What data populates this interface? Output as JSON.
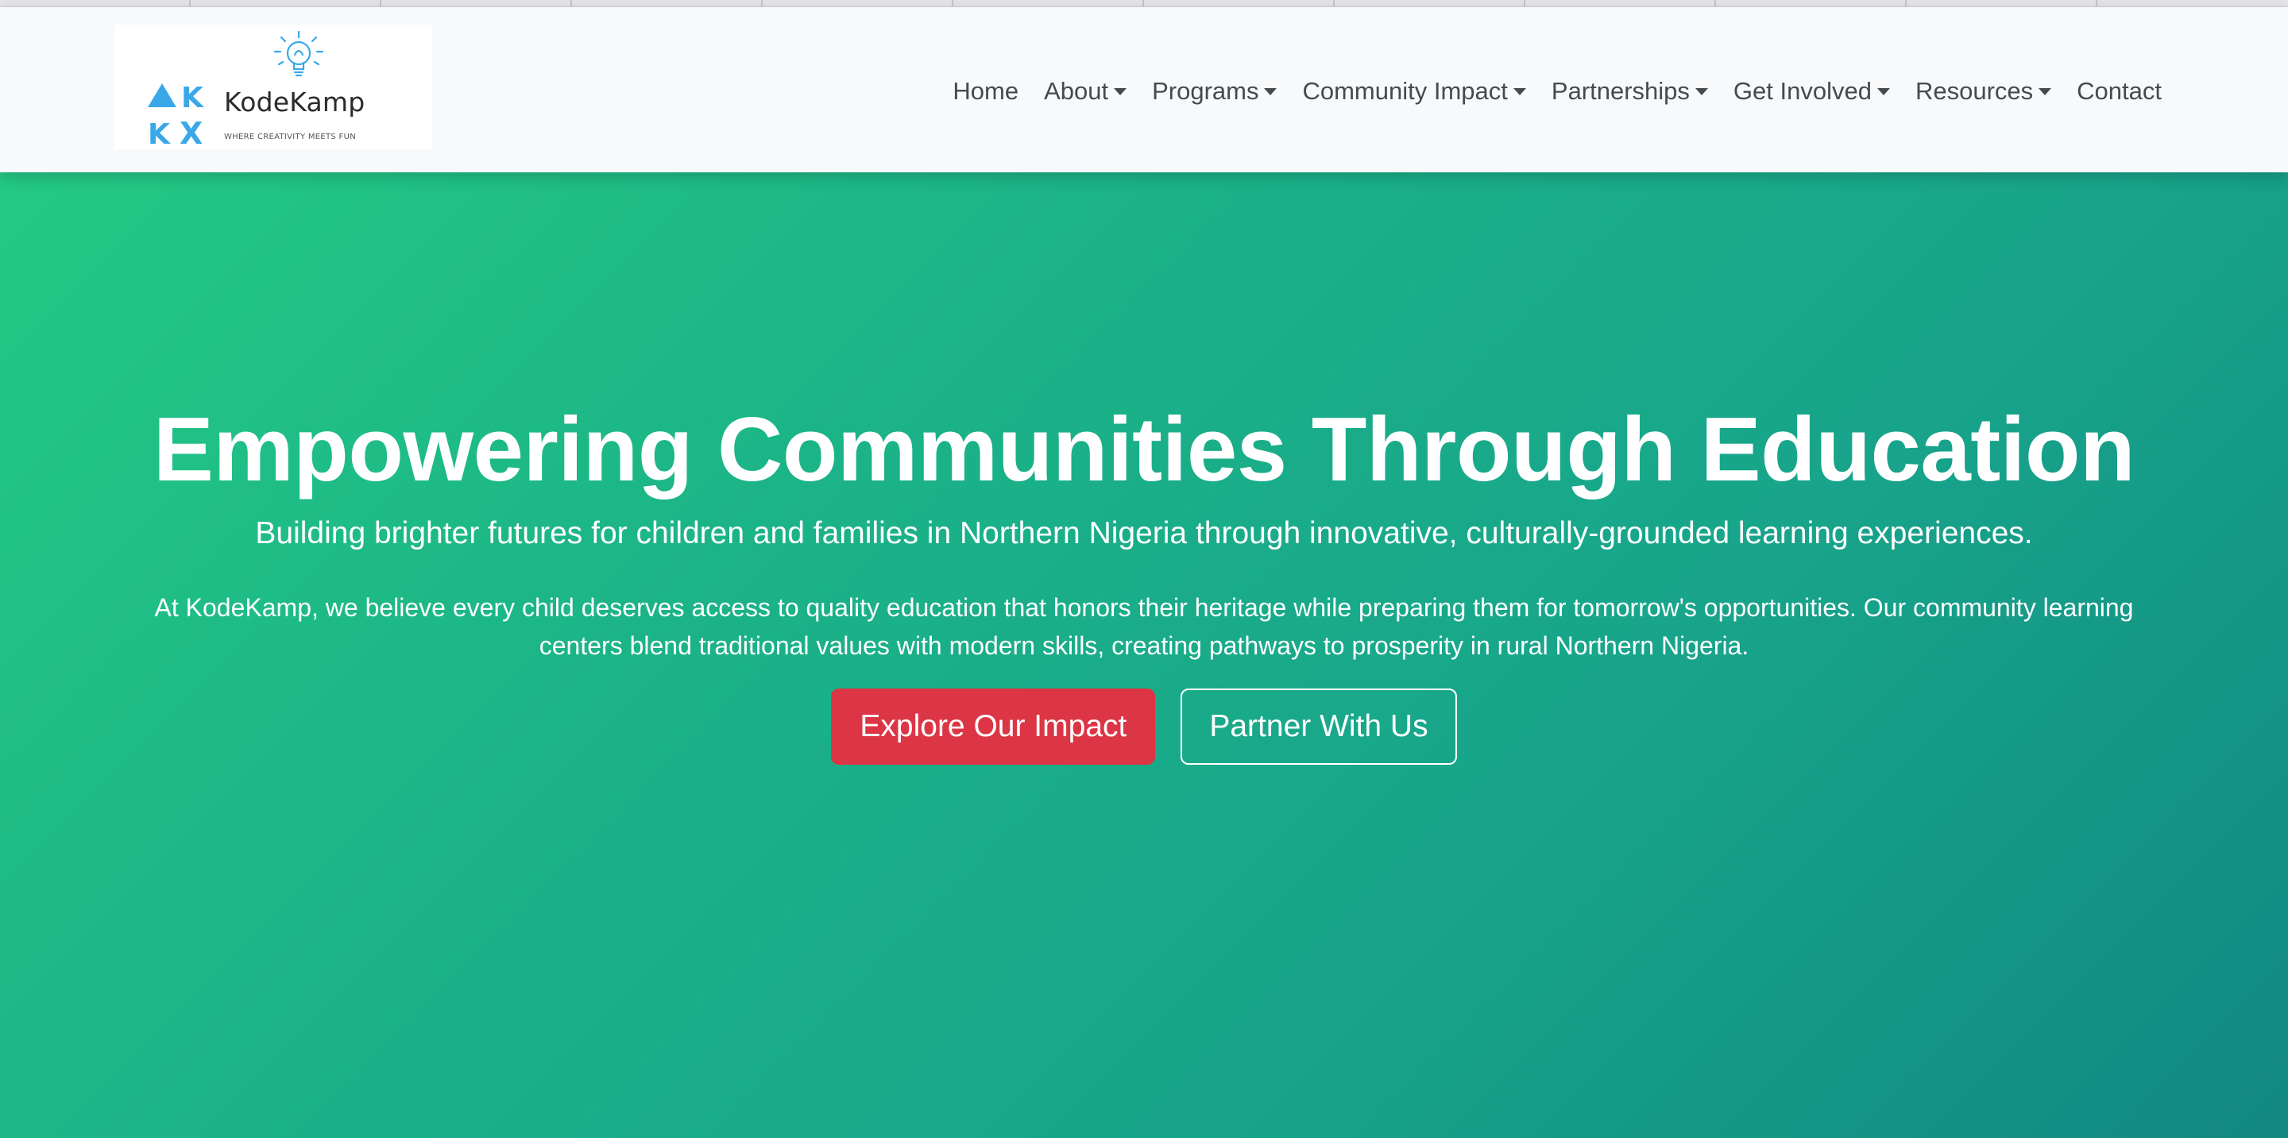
{
  "brand": {
    "name": "KodeKamp",
    "tagline": "WHERE CREATIVITY MEETS FUN",
    "logo_letters": [
      "A",
      "K",
      "K",
      "X"
    ],
    "logo_icon": "lightbulb-icon",
    "logo_color": "#3aa8e8"
  },
  "nav": {
    "items": [
      {
        "label": "Home",
        "has_dropdown": false
      },
      {
        "label": "About",
        "has_dropdown": true
      },
      {
        "label": "Programs",
        "has_dropdown": true
      },
      {
        "label": "Community Impact",
        "has_dropdown": true
      },
      {
        "label": "Partnerships",
        "has_dropdown": true
      },
      {
        "label": "Get Involved",
        "has_dropdown": true
      },
      {
        "label": "Resources",
        "has_dropdown": true
      },
      {
        "label": "Contact",
        "has_dropdown": false
      }
    ]
  },
  "hero": {
    "title": "Empowering Communities Through Education",
    "subtitle": "Building brighter futures for children and families in Northern Nigeria through innovative, culturally-grounded learning experiences.",
    "body": "At KodeKamp, we believe every child deserves access to quality education that honors their heritage while preparing them for tomorrow's opportunities. Our community learning centers blend traditional values with modern skills, creating pathways to prosperity in rural Northern Nigeria.",
    "primary_button": "Explore Our Impact",
    "secondary_button": "Partner With Us"
  },
  "colors": {
    "hero_gradient_start": "#24c985",
    "hero_gradient_end": "#118882",
    "primary_button": "#dc3545",
    "navbar_bg": "#f8f9fb",
    "nav_text": "#464a4f"
  }
}
